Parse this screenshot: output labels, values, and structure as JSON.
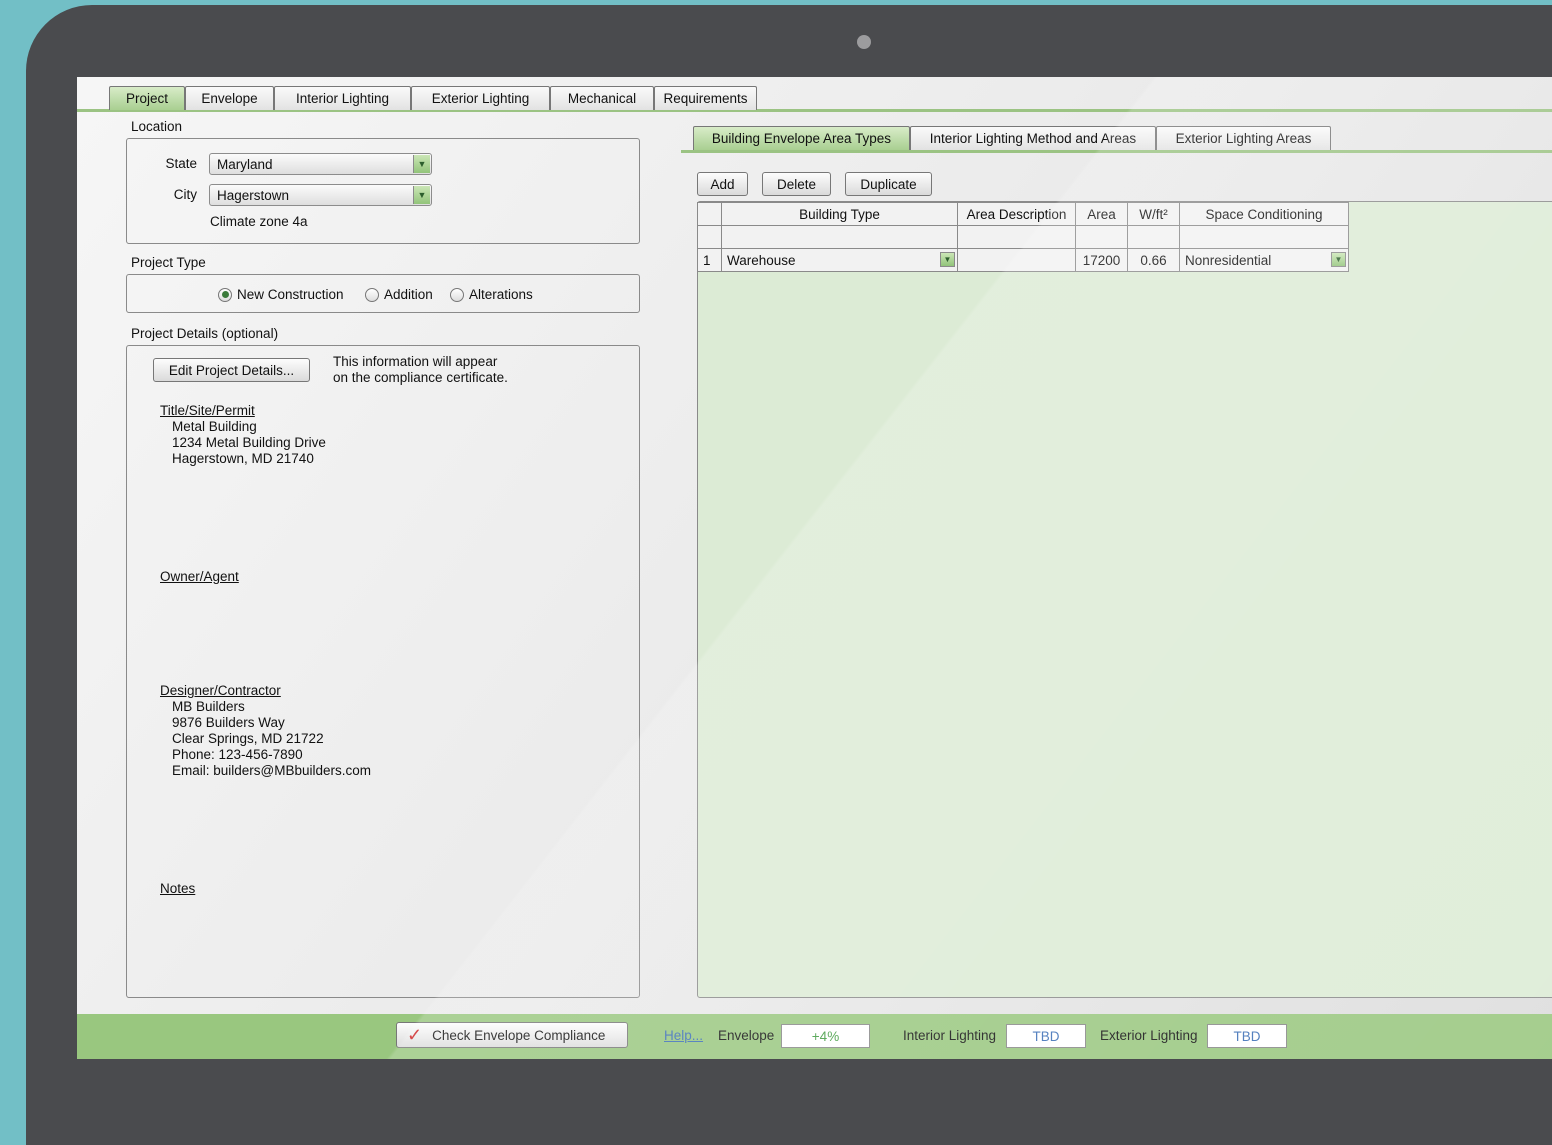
{
  "tabs": [
    "Project",
    "Envelope",
    "Interior Lighting",
    "Exterior Lighting",
    "Mechanical",
    "Requirements"
  ],
  "location": {
    "section_label": "Location",
    "state_label": "State",
    "state_value": "Maryland",
    "city_label": "City",
    "city_value": "Hagerstown",
    "climate_zone": "Climate zone 4a"
  },
  "project_type": {
    "section_label": "Project Type",
    "options": [
      "New Construction",
      "Addition",
      "Alterations"
    ],
    "selected": "New Construction"
  },
  "project_details": {
    "section_label": "Project Details (optional)",
    "edit_button": "Edit Project Details...",
    "info_line1": "This information will appear",
    "info_line2": "on the compliance certificate.",
    "title_heading": "Title/Site/Permit",
    "title_lines": "Metal Building\n1234 Metal Building Drive\nHagerstown, MD 21740",
    "owner_heading": "Owner/Agent",
    "designer_heading": "Designer/Contractor",
    "designer_lines": "MB Builders\n9876 Builders Way\nClear Springs, MD 21722\nPhone: 123-456-7890\nEmail: builders@MBbuilders.com",
    "notes_heading": "Notes"
  },
  "subtabs": [
    "Building Envelope Area Types",
    "Interior Lighting Method and Areas",
    "Exterior Lighting Areas"
  ],
  "grid_buttons": {
    "add": "Add",
    "delete": "Delete",
    "duplicate": "Duplicate"
  },
  "table": {
    "headers": [
      "",
      "Building Type",
      "Area Description",
      "Area",
      "W/ft²",
      "Space Conditioning"
    ],
    "rows": [
      {
        "num": "1",
        "building_type": "Warehouse",
        "area_description": "",
        "area": "17200",
        "wft": "0.66",
        "space_conditioning": "Nonresidential"
      }
    ]
  },
  "footer": {
    "check_button": "Check Envelope Compliance",
    "help_link": "Help...",
    "envelope_label": "Envelope",
    "envelope_value": "+4%",
    "interior_label": "Interior Lighting",
    "interior_value": "TBD",
    "exterior_label": "Exterior Lighting",
    "exterior_value": "TBD"
  },
  "colors": {
    "accent_green": "#99c77f",
    "envelope_value": "#3f9a3f",
    "tbd": "#3a6db5"
  }
}
